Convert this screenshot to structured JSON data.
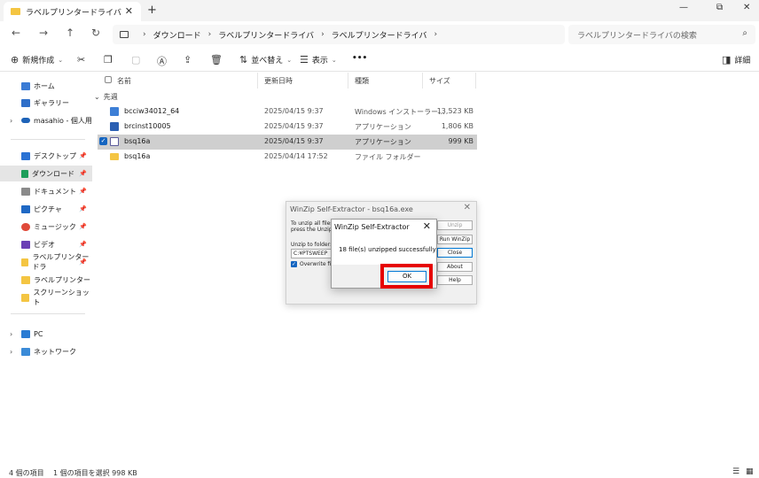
{
  "titlebar": {
    "tab_label": "ラベルプリンタードライバ",
    "tab_close": "✕",
    "new_tab": "+",
    "minimize": "—",
    "maximize": "⧉",
    "close": "✕"
  },
  "navbar": {
    "back": "←",
    "forward": "→",
    "up": "↑",
    "refresh": "↻",
    "breadcrumb": [
      "ダウンロード",
      "ラベルプリンタードライバ",
      "ラベルプリンタードライバ"
    ],
    "search_placeholder": "ラベルプリンタードライバの検索"
  },
  "toolbar": {
    "new_label": "新規作成",
    "sort_label": "並べ替え",
    "view_label": "表示",
    "more_label": "•••",
    "details_label": "詳細"
  },
  "sidebar": {
    "items": [
      {
        "label": "ホーム"
      },
      {
        "label": "ギャラリー"
      },
      {
        "label": "masahio - 個人用"
      },
      {
        "label": "デスクトップ"
      },
      {
        "label": "ダウンロード"
      },
      {
        "label": "ドキュメント"
      },
      {
        "label": "ピクチャ"
      },
      {
        "label": "ミュージック"
      },
      {
        "label": "ビデオ"
      },
      {
        "label": "ラベルプリンタードラ"
      },
      {
        "label": "ラベルプリンタードライバ"
      },
      {
        "label": "スクリーンショット"
      },
      {
        "label": "PC"
      },
      {
        "label": "ネットワーク"
      }
    ]
  },
  "filelist": {
    "headers": {
      "name": "名前",
      "date": "更新日時",
      "type": "種類",
      "size": "サイズ"
    },
    "group": "先週",
    "rows": [
      {
        "name": "bcciw34012_64",
        "date": "2025/04/15 9:37",
        "type": "Windows インストーラー...",
        "size": "13,523 KB"
      },
      {
        "name": "brcinst10005",
        "date": "2025/04/15 9:37",
        "type": "アプリケーション",
        "size": "1,806 KB"
      },
      {
        "name": "bsq16a",
        "date": "2025/04/15 9:37",
        "type": "アプリケーション",
        "size": "999 KB"
      },
      {
        "name": "bsq16a",
        "date": "2025/04/14 17:52",
        "type": "ファイル フォルダー",
        "size": ""
      }
    ]
  },
  "statusbar": {
    "count": "4 個の項目",
    "selection": "1 個の項目を選択  998 KB"
  },
  "winzip_back": {
    "title": "WinZip Self-Extractor - bsq16a.exe",
    "line1": "To unzip all files",
    "line2": "press the Unzip",
    "unzip_to_label": "Unzip to folder:",
    "folder_value": "C:¥PTSWEEP",
    "overwrite_label": "Overwrite file",
    "unzip_btn": "Unzip",
    "run_btn": "Run WinZip",
    "close_btn": "Close",
    "about_btn": "About",
    "help_btn": "Help"
  },
  "message": {
    "title": "WinZip Self-Extractor",
    "text": "18 file(s) unzipped successfully",
    "ok": "OK"
  }
}
